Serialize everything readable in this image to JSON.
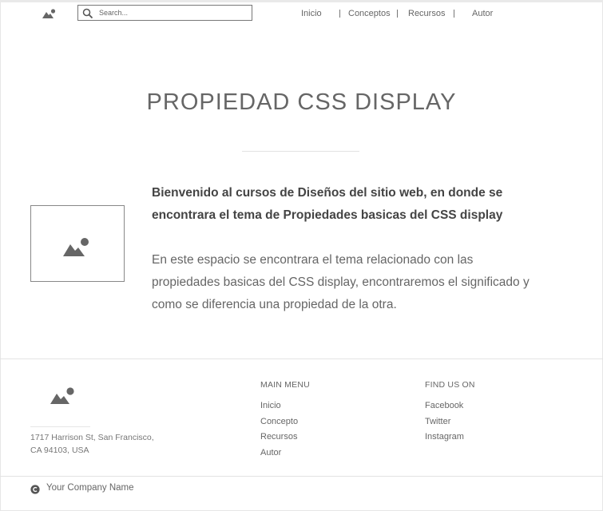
{
  "search": {
    "placeholder": "Search..."
  },
  "nav": {
    "items": [
      "Inicio",
      "Conceptos",
      "Recursos",
      "Autor"
    ]
  },
  "hero": {
    "title": "PROPIEDAD CSS DISPLAY",
    "lead": "Bienvenido al cursos de Diseños del sitio web, en donde se encontrara el tema de Propiedades basicas del CSS display",
    "body": "En este espacio se encontrara el tema relacionado con las propiedades basicas del CSS display, encontraremos el significado y como se diferencia una propiedad de la otra."
  },
  "footer": {
    "address_line1": "1717 Harrison St, San Francisco,",
    "address_line2": "CA 94103, USA",
    "main_menu": {
      "heading": "MAIN MENU",
      "items": [
        "Inicio",
        "Concepto",
        "Recursos",
        "Autor"
      ]
    },
    "find_us": {
      "heading": "FIND US ON",
      "items": [
        "Facebook",
        "Twitter",
        "Instagram"
      ]
    },
    "company": "Your Company Name"
  },
  "icons": {
    "logo": "image-placeholder-icon",
    "search": "search-icon",
    "copyright": "copyright-icon"
  },
  "colors": {
    "text": "#555555",
    "muted": "#777777",
    "rule": "#e3e3e3"
  }
}
